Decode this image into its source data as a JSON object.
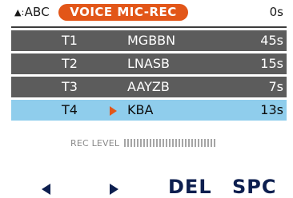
{
  "header": {
    "mode_icon": "triangle-pair-icon",
    "mode_label": "ABC",
    "title": "VOICE MIC-REC",
    "total_time": "0s"
  },
  "tracks": [
    {
      "num": "T1",
      "name": "MGBBN",
      "duration": "45s",
      "selected": false
    },
    {
      "num": "T2",
      "name": "LNASB",
      "duration": "15s",
      "selected": false
    },
    {
      "num": "T3",
      "name": "AAYZB",
      "duration": "7s",
      "selected": false
    },
    {
      "num": "T4",
      "name": "KBA",
      "duration": "13s",
      "selected": true
    }
  ],
  "rec_level": {
    "label": "REC LEVEL",
    "level": 0
  },
  "softkeys": {
    "left_icon": "left-arrow-icon",
    "right_icon": "right-arrow-icon",
    "del_label": "DEL",
    "spc_label": "SPC"
  },
  "colors": {
    "accent": "#e25618",
    "row_bg": "#5c5c5c",
    "selected_bg": "#8fcdec",
    "softkey": "#0d1f4f"
  }
}
